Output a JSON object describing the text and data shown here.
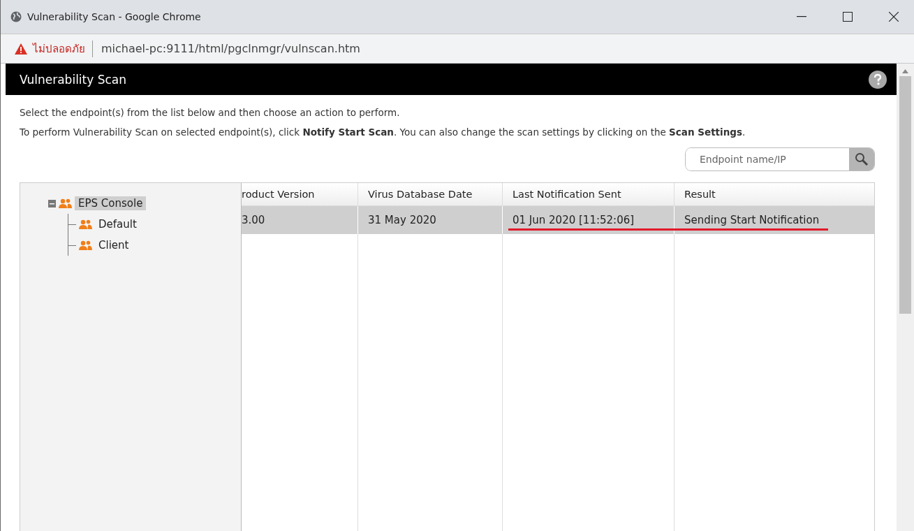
{
  "window": {
    "title": "Vulnerability Scan - Google Chrome"
  },
  "address_bar": {
    "security": "ไม่ปลอดภัย",
    "url": "michael-pc:9111/html/pgclnmgr/vulnscan.htm"
  },
  "page": {
    "title": "Vulnerability Scan",
    "instructions": [
      "Select the endpoint(s) from the list below and then choose an action to perform.",
      "To perform Vulnerability Scan on selected endpoint(s), click **Notify Start Scan**. You can also change the scan settings by clicking on the **Scan Settings**."
    ],
    "search": {
      "placeholder": "Endpoint name/IP"
    },
    "tree": [
      {
        "label": "EPS Console",
        "selected": true,
        "expanded": true,
        "children": [
          {
            "label": "Default",
            "selected": false
          },
          {
            "label": "Client",
            "selected": false
          }
        ]
      }
    ],
    "table": {
      "columns": [
        "roduct Version",
        "Virus Database Date",
        "Last Notification Sent",
        "Result"
      ],
      "rows": [
        {
          "selected": true,
          "cells": [
            "3.00",
            "31 May 2020",
            "01 Jun 2020 [11:52:06]",
            "Sending Start Notification"
          ]
        }
      ]
    }
  }
}
